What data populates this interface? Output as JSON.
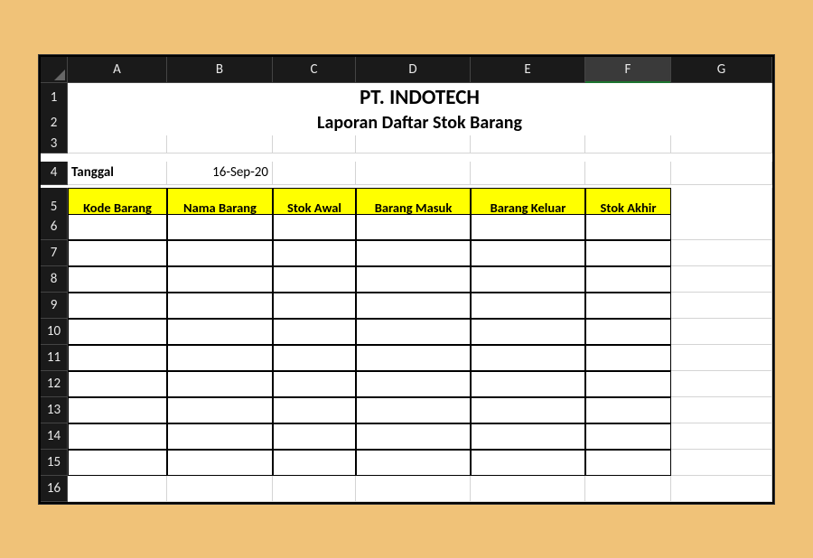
{
  "columns": [
    "A",
    "B",
    "C",
    "D",
    "E",
    "F",
    "G"
  ],
  "selected_column_index": 5,
  "rows": [
    1,
    2,
    3,
    4,
    5,
    6,
    7,
    8,
    9,
    10,
    11,
    12,
    13,
    14,
    15,
    16
  ],
  "title": "PT. INDOTECH",
  "subtitle": "Laporan Daftar Stok Barang",
  "date_label": "Tanggal",
  "date_value": "16-Sep-20",
  "table_headers": [
    "Kode Barang",
    "Nama Barang",
    "Stok Awal",
    "Barang Masuk",
    "Barang Keluar",
    "Stok Akhir"
  ],
  "data_row_count": 10
}
